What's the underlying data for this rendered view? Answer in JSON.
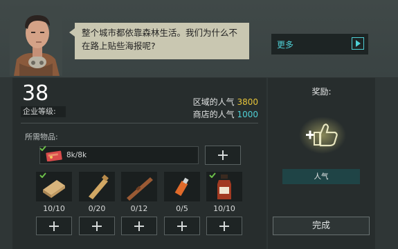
{
  "dialog": {
    "text_line1": "整个城市都依靠森林生活。我们为什么不",
    "text_line2": "在路上贴些海报呢?",
    "more_label": "更多"
  },
  "company": {
    "level": "38",
    "level_label": "企业等级:"
  },
  "stats": {
    "region_label": "区域的人气",
    "region_value": "3800",
    "shop_label": "商店的人气",
    "shop_value": "1000"
  },
  "requirements": {
    "title": "所需物品:",
    "money": {
      "icon": "money-card-icon",
      "amount": "8k/8k"
    },
    "items": [
      {
        "icon": "wood-plank-icon",
        "count": "10/10",
        "complete": true
      },
      {
        "icon": "wooden-bat-icon",
        "count": "0/20",
        "complete": false
      },
      {
        "icon": "wooden-stick-icon",
        "count": "0/12",
        "complete": false
      },
      {
        "icon": "usb-stick-icon",
        "count": "0/5",
        "complete": false
      },
      {
        "icon": "medicine-bottle-icon",
        "count": "10/10",
        "complete": true
      }
    ]
  },
  "reward": {
    "title": "奖励:",
    "icon": "thumbs-up-plus-icon",
    "tag": "人气"
  },
  "actions": {
    "complete_label": "完成"
  },
  "colors": {
    "accent_cyan": "#4fd0d6",
    "accent_yellow": "#e8c53a",
    "check_green": "#6cc04a"
  }
}
